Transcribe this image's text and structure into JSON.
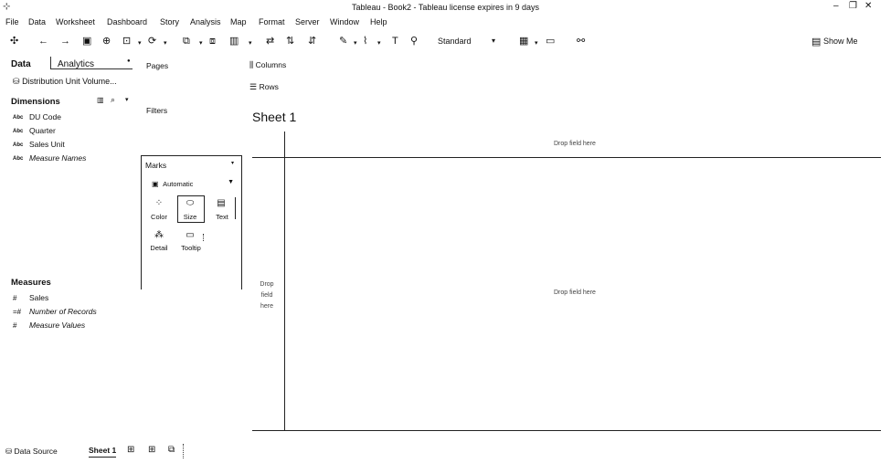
{
  "window": {
    "title": "Tableau - Book2 - Tableau license expires in 9 days",
    "app_icon": "tableau-app-icon",
    "controls": {
      "minimize": "–",
      "restore": "❐",
      "close": "✕"
    }
  },
  "menu": [
    "File",
    "Data",
    "Worksheet",
    "Dashboard",
    "Story",
    "Analysis",
    "Map",
    "Format",
    "Server",
    "Window",
    "Help"
  ],
  "toolbar": {
    "fit_dropdown": "Standard",
    "show_me": "Show Me"
  },
  "data_pane": {
    "tab_data": "Data",
    "tab_analytics": "Analytics",
    "data_source": "Distribution Unit Volume...",
    "dimensions_header": "Dimensions",
    "dimensions": [
      {
        "type": "Abc",
        "name": "DU Code",
        "italic": false
      },
      {
        "type": "Abc",
        "name": "Quarter",
        "italic": false
      },
      {
        "type": "Abc",
        "name": "Sales Unit",
        "italic": false
      },
      {
        "type": "Abc",
        "name": "Measure Names",
        "italic": true
      }
    ],
    "measures_header": "Measures",
    "measures": [
      {
        "type": "#",
        "name": "Sales",
        "italic": false
      },
      {
        "type": "=#",
        "name": "Number of Records",
        "italic": true
      },
      {
        "type": "#",
        "name": "Measure Values",
        "italic": true
      }
    ]
  },
  "shelves": {
    "pages": "Pages",
    "filters": "Filters",
    "columns": "Columns",
    "rows": "Rows"
  },
  "marks": {
    "header": "Marks",
    "type": "Automatic",
    "buttons": [
      "Color",
      "Size",
      "Text",
      "Detail",
      "Tooltip"
    ]
  },
  "canvas": {
    "sheet_title": "Sheet 1",
    "drop_top": "Drop field here",
    "drop_center": "Drop field here",
    "drop_left_lines": [
      "Drop",
      "field",
      "here"
    ]
  },
  "bottom_bar": {
    "data_source": "Data Source",
    "sheet_tab": "Sheet 1"
  }
}
